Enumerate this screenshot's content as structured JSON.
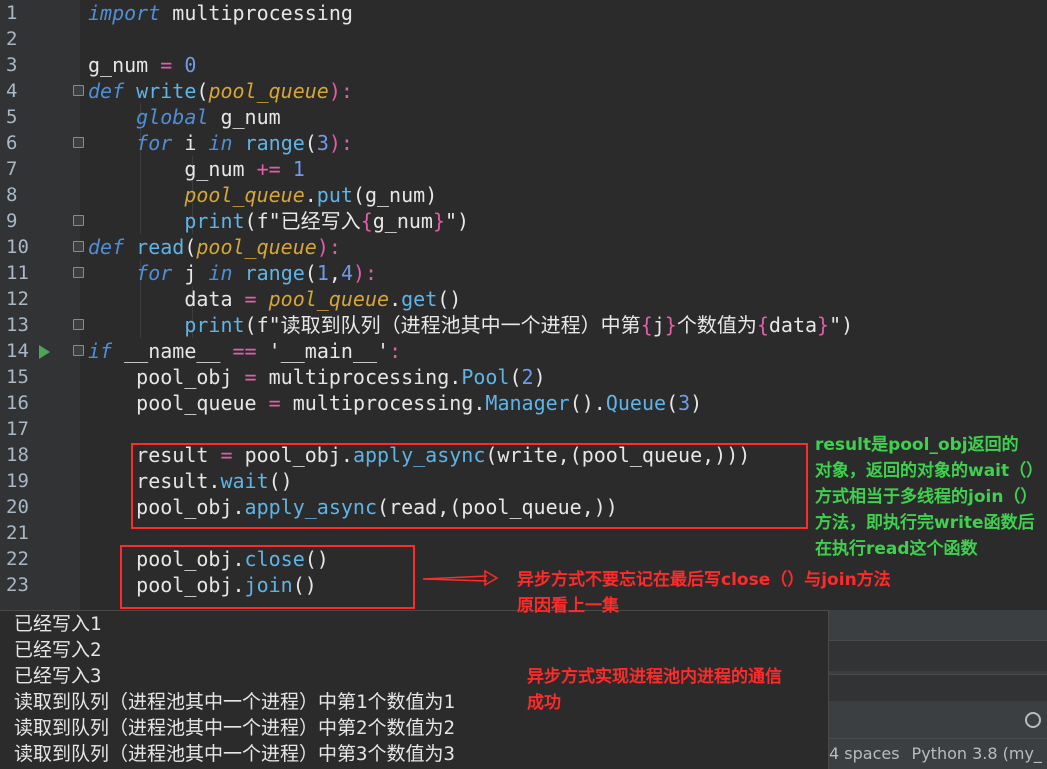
{
  "editor": {
    "line_numbers": [
      "1",
      "2",
      "3",
      "4",
      "5",
      "6",
      "7",
      "8",
      "9",
      "10",
      "11",
      "12",
      "13",
      "14",
      "15",
      "16",
      "17",
      "18",
      "19",
      "20",
      "21",
      "22",
      "23"
    ],
    "tokens": {
      "import": "import",
      "module": "multiprocessing",
      "g_num": "g_num",
      "eq": "=",
      "zero": "0",
      "def": "def",
      "write": "write",
      "read": "read",
      "pool_queue": "pool_queue",
      "lparen": "(",
      "rparen_colon": "):",
      "global": "global",
      "for": "for",
      "in": "in",
      "range": "range",
      "i": "i",
      "j": "j",
      "three": "3",
      "pluseq": "+=",
      "one": "1",
      "dot": ".",
      "put": "put",
      "get": "get",
      "print": "print",
      "f": "f",
      "fstr1": "\"已经写入",
      "fstr2": "\"读取到队列（进程池其中一个进程）中第",
      "lbrace": "{",
      "rbrace": "}",
      "mid2": "个数值为",
      "q_rparen": "\")",
      "data": "data",
      "call_empty": "()",
      "range_args_1": "1",
      "comma": ",",
      "four": "4",
      "if": "if",
      "name": "__name__",
      "eqeq": "==",
      "main": "'__main__'",
      "colon": ":",
      "pool_obj": "pool_obj",
      "Pool": "Pool",
      "two": "2",
      "Manager": "Manager",
      "Queue": "Queue",
      "result": "result",
      "apply_async": "apply_async",
      "wait": "wait",
      "close": "close",
      "join": "join",
      "args_write": "(write,(pool_queue,))",
      "args_read": "(read,(pool_queue,))"
    }
  },
  "annotations": {
    "green": [
      "result是pool_obj返回的",
      "对象，返回的对象的wait（）",
      "方式相当于多线程的join（）",
      "方法，即执行完write函数后",
      "在执行read这个函数"
    ],
    "red_1": "异步方式不要忘记在最后写close（）与join方法",
    "red_2": "原因看上一集",
    "red_3_line1": "异步方式实现进程池内进程的通信",
    "red_3_line2": "成功"
  },
  "console": {
    "lines": [
      "已经写入1",
      "已经写入2",
      "已经写入3",
      "读取到队列（进程池其中一个进程）中第1个数值为1",
      "读取到队列（进程池其中一个进程）中第2个数值为2",
      "读取到队列（进程池其中一个进程）中第3个数值为3"
    ]
  },
  "statusbar": {
    "indent": "4 spaces",
    "interpreter": "Python 3.8 (my_"
  },
  "colors": {
    "background": "#2b2b2b",
    "keyword": "#4f8fd8",
    "parameter": "#d6a537",
    "operator": "#e05fa9",
    "annotation_red": "#ff2a2a",
    "annotation_green": "#3fd04f"
  }
}
